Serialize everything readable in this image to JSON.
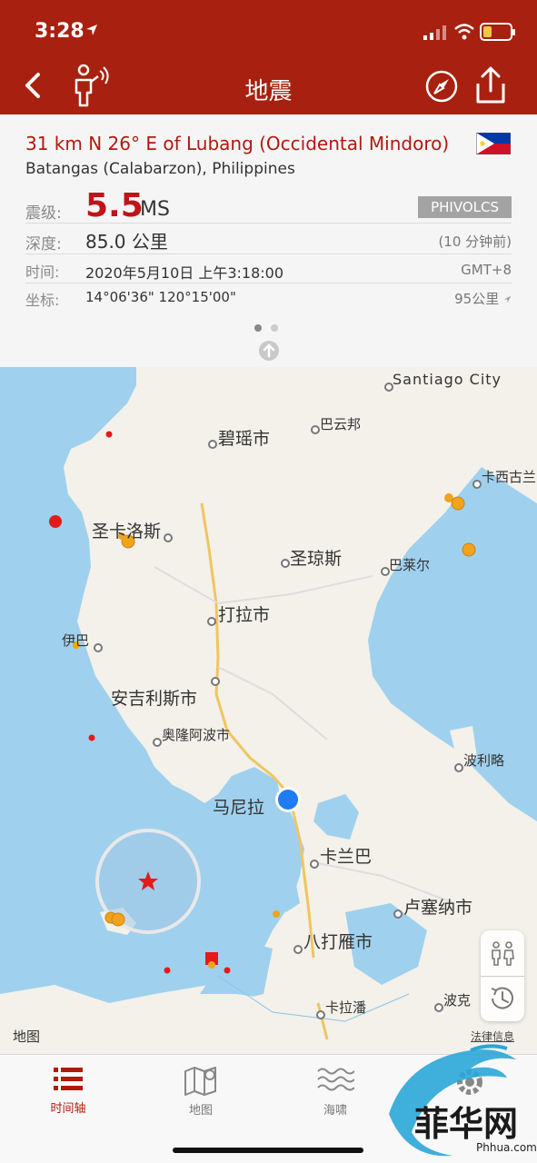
{
  "status": {
    "time": "3:28"
  },
  "nav": {
    "title": "地震"
  },
  "quake": {
    "title": "31 km N 26° E of Lubang (Occidental Mindoro)",
    "region": "Batangas (Calabarzon), Philippines",
    "magnitude_label": "震级:",
    "magnitude": "5.5",
    "magnitude_type": "MS",
    "agency": "PHIVOLCS",
    "depth_label": "深度:",
    "depth": "85.0 公里",
    "depth_ago": "(10 分钟前)",
    "time_label": "时间:",
    "time": "2020年5月10日 上午3:18:00",
    "timezone": "GMT+8",
    "coord_label": "坐标:",
    "coords": "14°06'36\"   120°15'00\"",
    "distance": "95公里"
  },
  "map": {
    "cities": {
      "santiago": "Santiago City",
      "baguio": "碧瑶市",
      "bayombong": "巴云邦",
      "casiguran": "卡西古兰",
      "san_carlos": "圣卡洛斯",
      "san_jose": "圣琼斯",
      "baler": "巴莱尔",
      "tarlac": "打拉市",
      "iba": "伊巴",
      "angeles": "安吉利斯市",
      "olongapo": "奥隆阿波市",
      "polillo": "波利略",
      "manila": "马尼拉",
      "calamba": "卡兰巴",
      "lucena": "卢塞纳市",
      "batangas": "八打雁市",
      "calapan": "卡拉潘",
      "boac": "波克"
    },
    "apple_maps_label": "地图",
    "legal_label": "法律信息"
  },
  "tabs": [
    {
      "label": "时间轴"
    },
    {
      "label": "地图"
    },
    {
      "label": "海啸"
    }
  ],
  "watermark": {
    "text": "菲华网",
    "url": "Phhua.com"
  },
  "colors": {
    "header": "#a8200f",
    "accent": "#b3180f",
    "magnitude": "#c0141a",
    "sea": "#9fd1ee",
    "land": "#f3f1ea"
  }
}
